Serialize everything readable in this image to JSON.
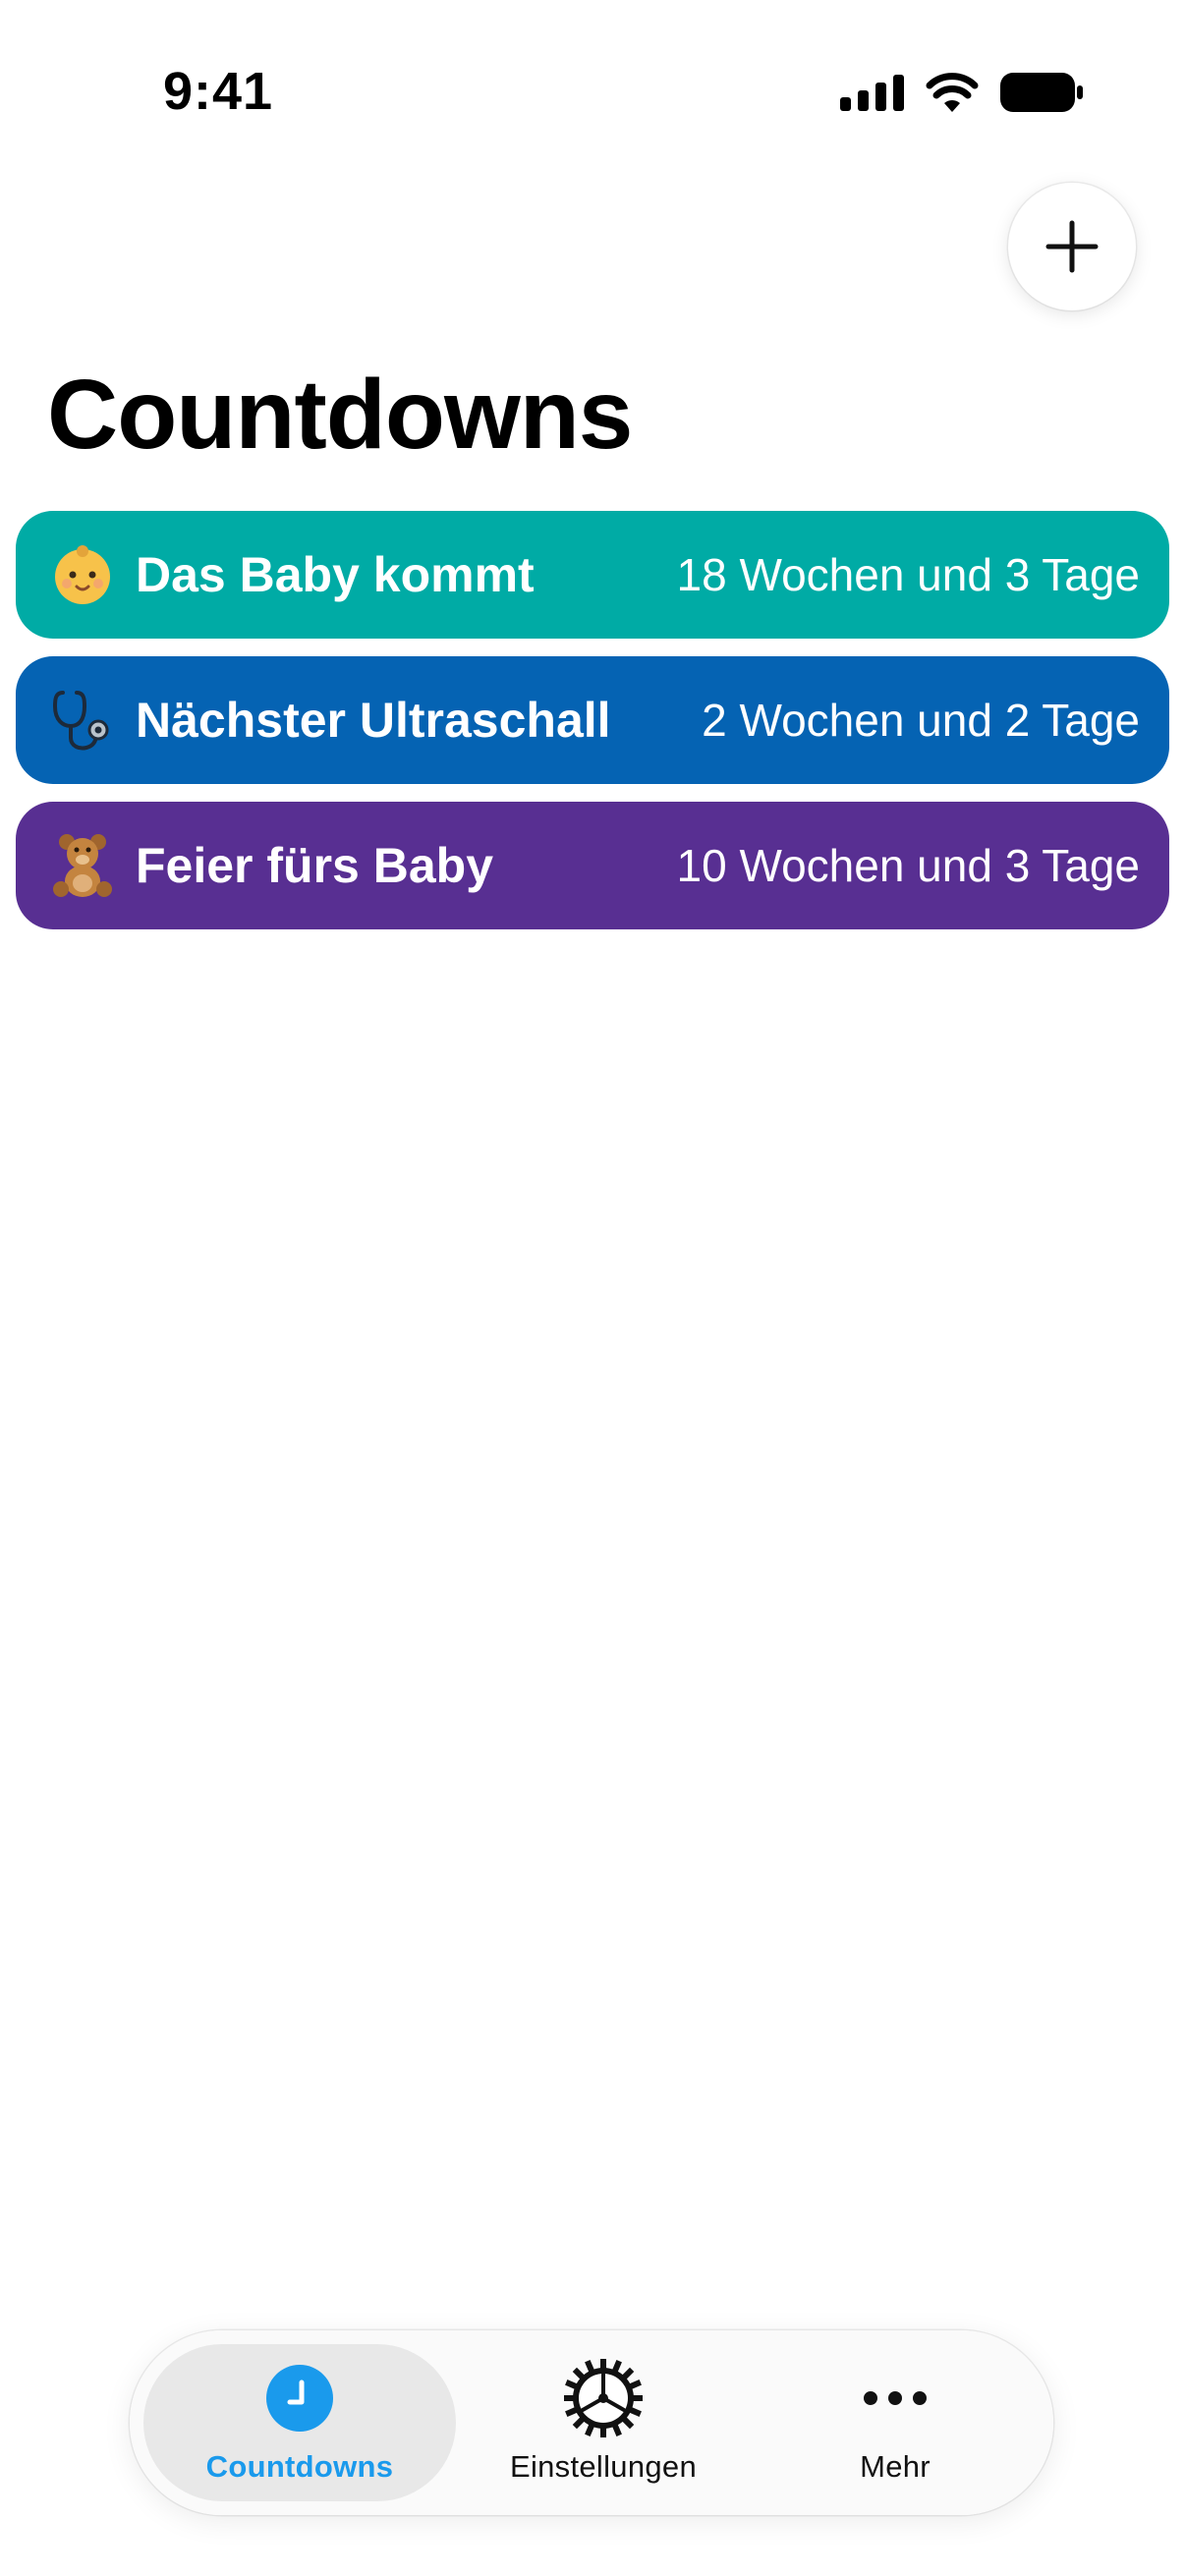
{
  "status_bar": {
    "time": "9:41"
  },
  "header": {
    "title": "Countdowns",
    "add_button_icon": "plus-icon"
  },
  "countdowns": [
    {
      "emoji": "👶",
      "title": "Das Baby kommt",
      "remaining": "18 Wochen und 3 Tage",
      "color": "#00aba5"
    },
    {
      "emoji": "🩺",
      "title": "Nächster Ultraschall",
      "remaining": "2 Wochen und 2 Tage",
      "color": "#0563b3"
    },
    {
      "emoji": "🧸",
      "title": "Feier fürs Baby",
      "remaining": "10 Wochen und 3 Tage",
      "color": "#582f92"
    }
  ],
  "tab_bar": {
    "tabs": [
      {
        "label": "Countdowns",
        "icon": "clock-icon",
        "active": true
      },
      {
        "label": "Einstellungen",
        "icon": "gear-icon",
        "active": false
      },
      {
        "label": "Mehr",
        "icon": "ellipsis-icon",
        "active": false
      }
    ],
    "accent_color": "#1a9aec"
  }
}
